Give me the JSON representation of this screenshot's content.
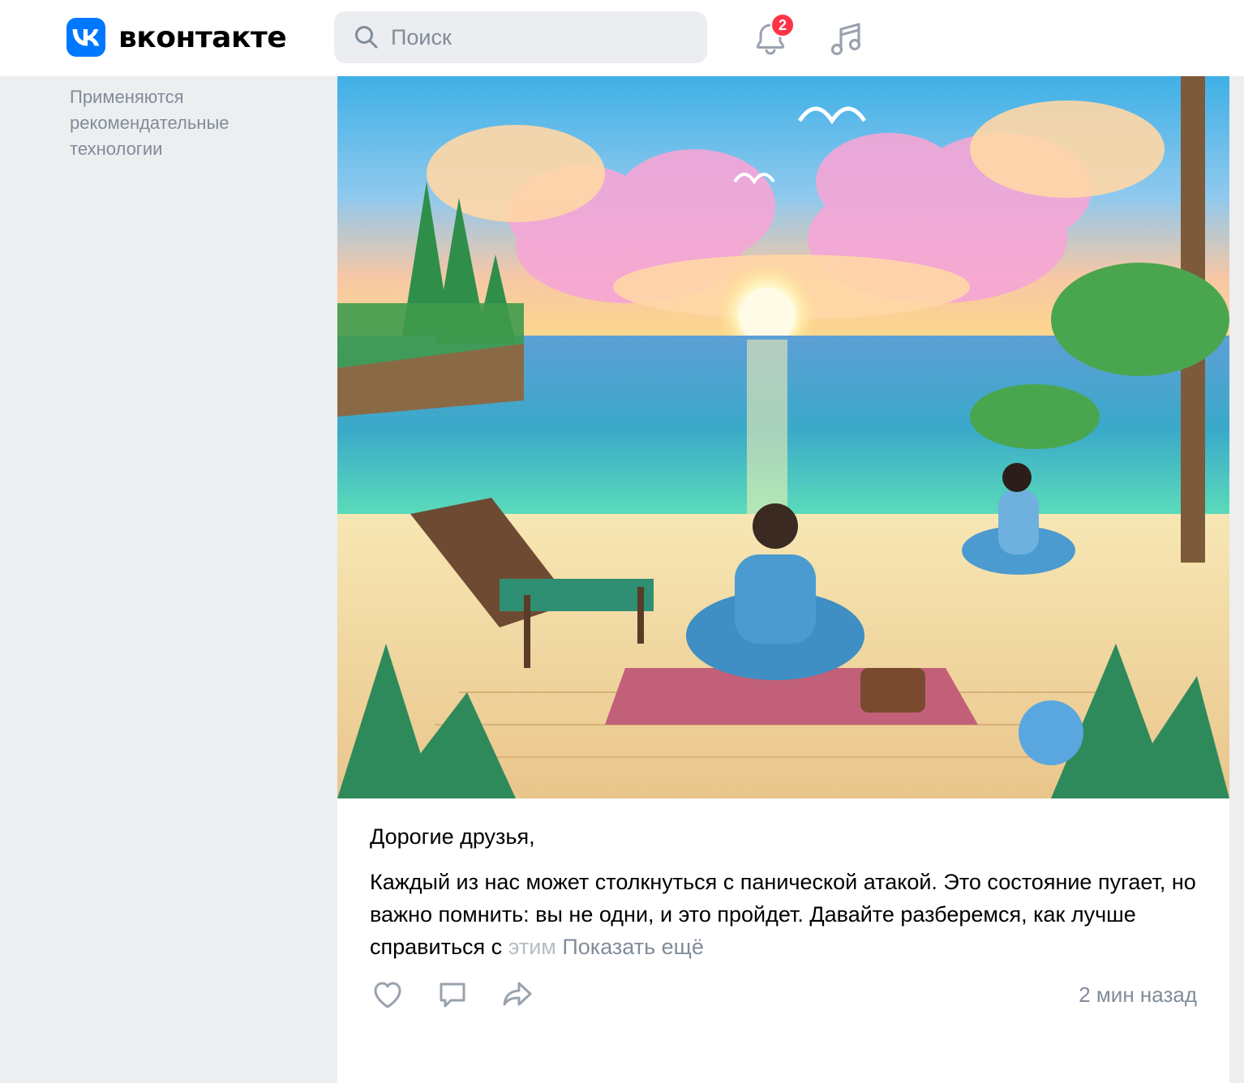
{
  "header": {
    "logo_text": "вконтакте",
    "search_placeholder": "Поиск",
    "notifications_count": "2",
    "brand_color": "#0077ff",
    "badge_color": "#ff3347",
    "icons": [
      "vk-logo-icon",
      "search-icon",
      "bell-icon",
      "music-icon"
    ]
  },
  "sidebar": {
    "note": "Применяются рекомендательные технологии"
  },
  "post": {
    "greeting": "Дорогие друзья,",
    "body": "Каждый из нас может столкнуться с панической атакой. Это состояние пугает, но важно помнить: вы не одни, и это пройдет. Давайте разберемся, как лучше справиться с ",
    "body_fade": "этим",
    "show_more": "Показать ещё",
    "time": "2 мин назад",
    "actions": [
      "like-icon",
      "comment-icon",
      "share-icon"
    ]
  }
}
